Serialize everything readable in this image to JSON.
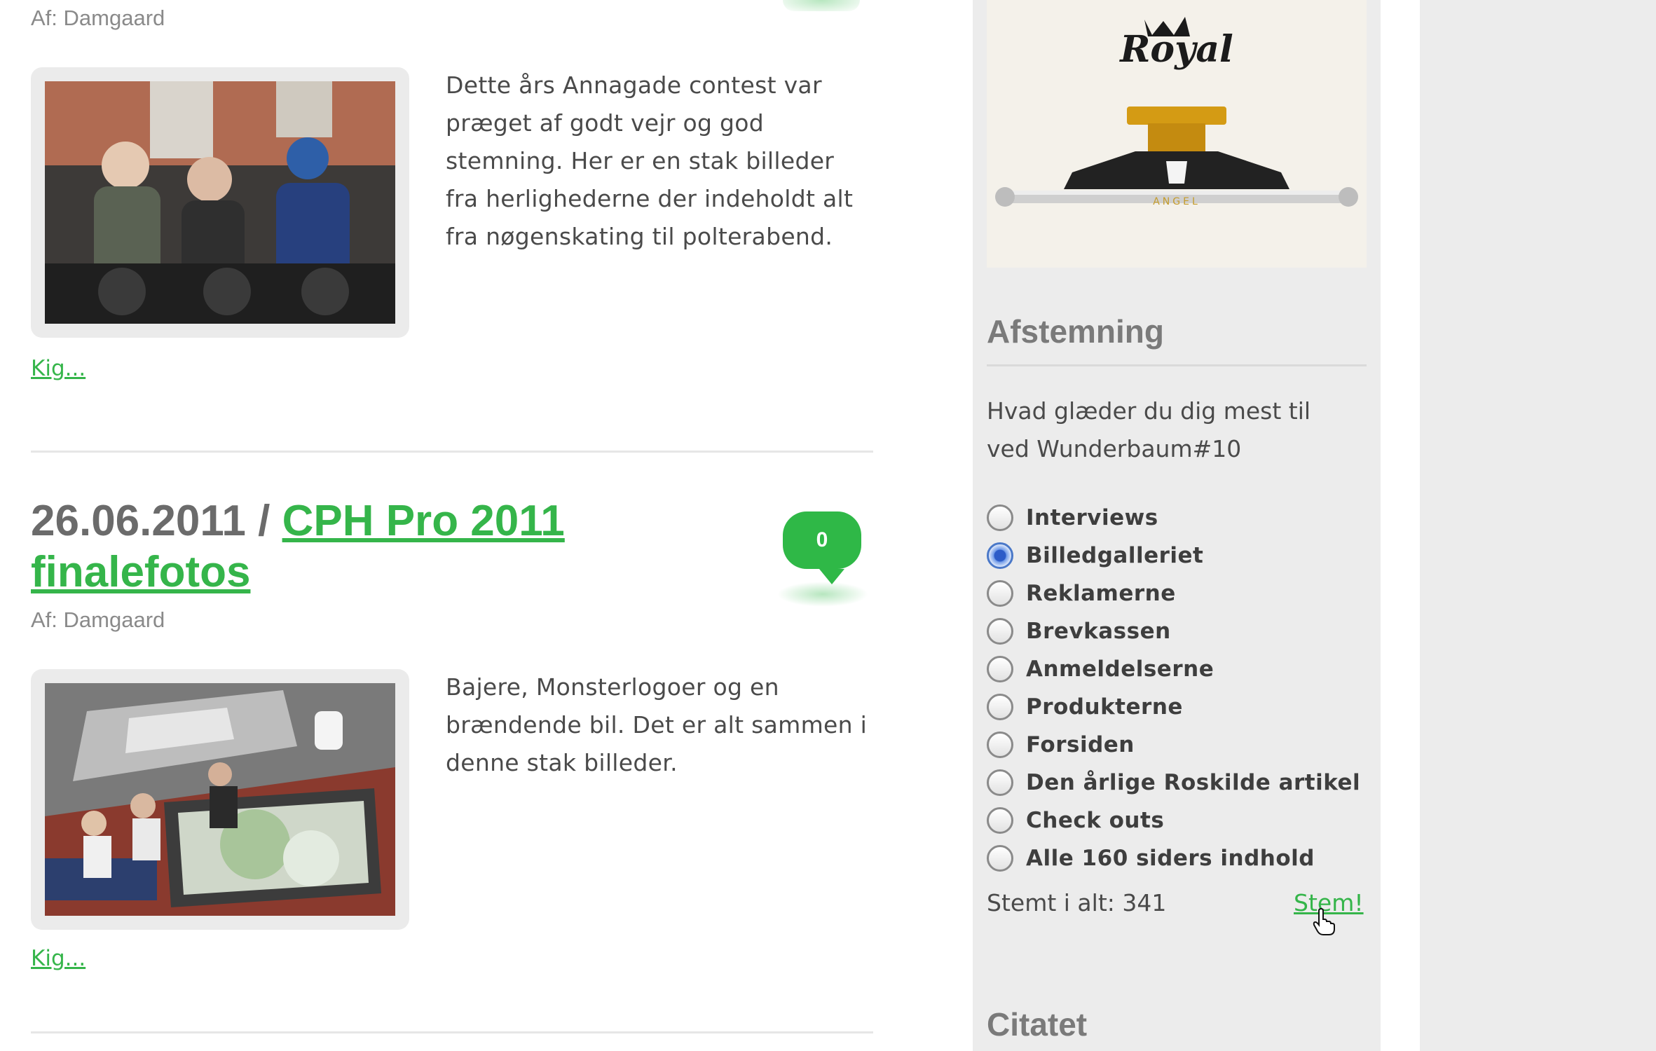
{
  "posts": [
    {
      "author": "Af: Damgaard",
      "excerpt": "Dette års Annagade contest var præget af godt vejr og god stemning. Her er en stak billeder fra herlighederne der indeholdt alt fra nøgenskating til polterabend.",
      "read_more": "Kig..."
    },
    {
      "date": "26.06.2011 /",
      "title": "CPH Pro 2011 finalefotos",
      "comments": "0",
      "author": "Af: Damgaard",
      "excerpt": "Bajere, Monsterlogoer og en brændende bil. Det er alt sammen i denne stak billeder.",
      "read_more": "Kig..."
    }
  ],
  "ad": {
    "brand": "Royal",
    "product_text": "ANGEL"
  },
  "poll": {
    "heading": "Afstemning",
    "question": "Hvad glæder du dig mest til ved Wunderbaum#10",
    "options": [
      "Interviews",
      "Billedgalleriet",
      "Reklamerne",
      "Brevkassen",
      "Anmeldelserne",
      "Produkterne",
      "Forsiden",
      "Den årlige Roskilde artikel",
      "Check outs",
      "Alle 160 siders indhold"
    ],
    "selected": "Billedgalleriet",
    "total": "Stemt i alt: 341",
    "vote_label": "Stem!"
  },
  "quote": {
    "heading": "Citatet"
  },
  "colors": {
    "accent": "#35b54a",
    "sidebar_bg": "#ececec",
    "selected_radio": "#2d5cc8"
  }
}
